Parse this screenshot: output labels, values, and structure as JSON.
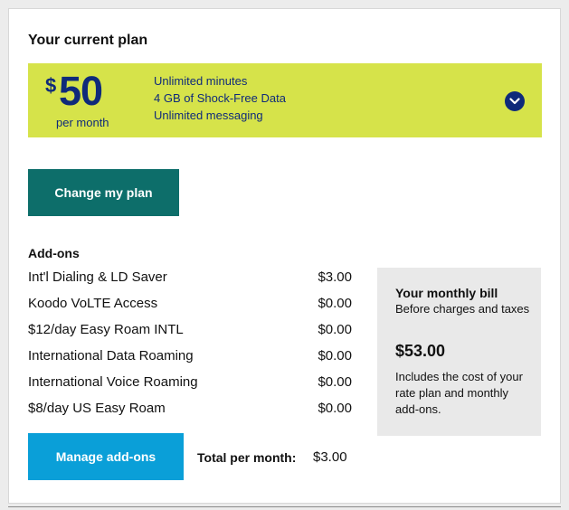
{
  "section_title": "Your current plan",
  "plan": {
    "currency_symbol": "$",
    "amount": "50",
    "period": "per month",
    "features": [
      "Unlimited minutes",
      "4 GB of Shock-Free Data",
      "Unlimited messaging"
    ],
    "expand_icon": "chevron-down-icon",
    "banner_color": "#d6e34a",
    "text_color": "#0f2a7a"
  },
  "change_plan_label": "Change my plan",
  "addons": {
    "heading": "Add-ons",
    "items": [
      {
        "name": "Int'l Dialing & LD Saver",
        "price": "$3.00"
      },
      {
        "name": "Koodo VoLTE Access",
        "price": "$0.00"
      },
      {
        "name": "$12/day Easy Roam INTL",
        "price": "$0.00"
      },
      {
        "name": "International Data Roaming",
        "price": "$0.00"
      },
      {
        "name": "International Voice Roaming",
        "price": "$0.00"
      },
      {
        "name": "$8/day US Easy Roam",
        "price": "$0.00"
      }
    ],
    "manage_label": "Manage add-ons",
    "total_label": "Total per month:",
    "total_value": "$3.00"
  },
  "bill": {
    "title": "Your monthly bill",
    "subtitle": "Before charges and taxes",
    "amount": "$53.00",
    "note": "Includes the cost of your rate plan and monthly add-ons."
  },
  "colors": {
    "change_plan_button": "#0d6e6a",
    "manage_button": "#0a9fd8",
    "bill_box": "#e9e9e9"
  }
}
